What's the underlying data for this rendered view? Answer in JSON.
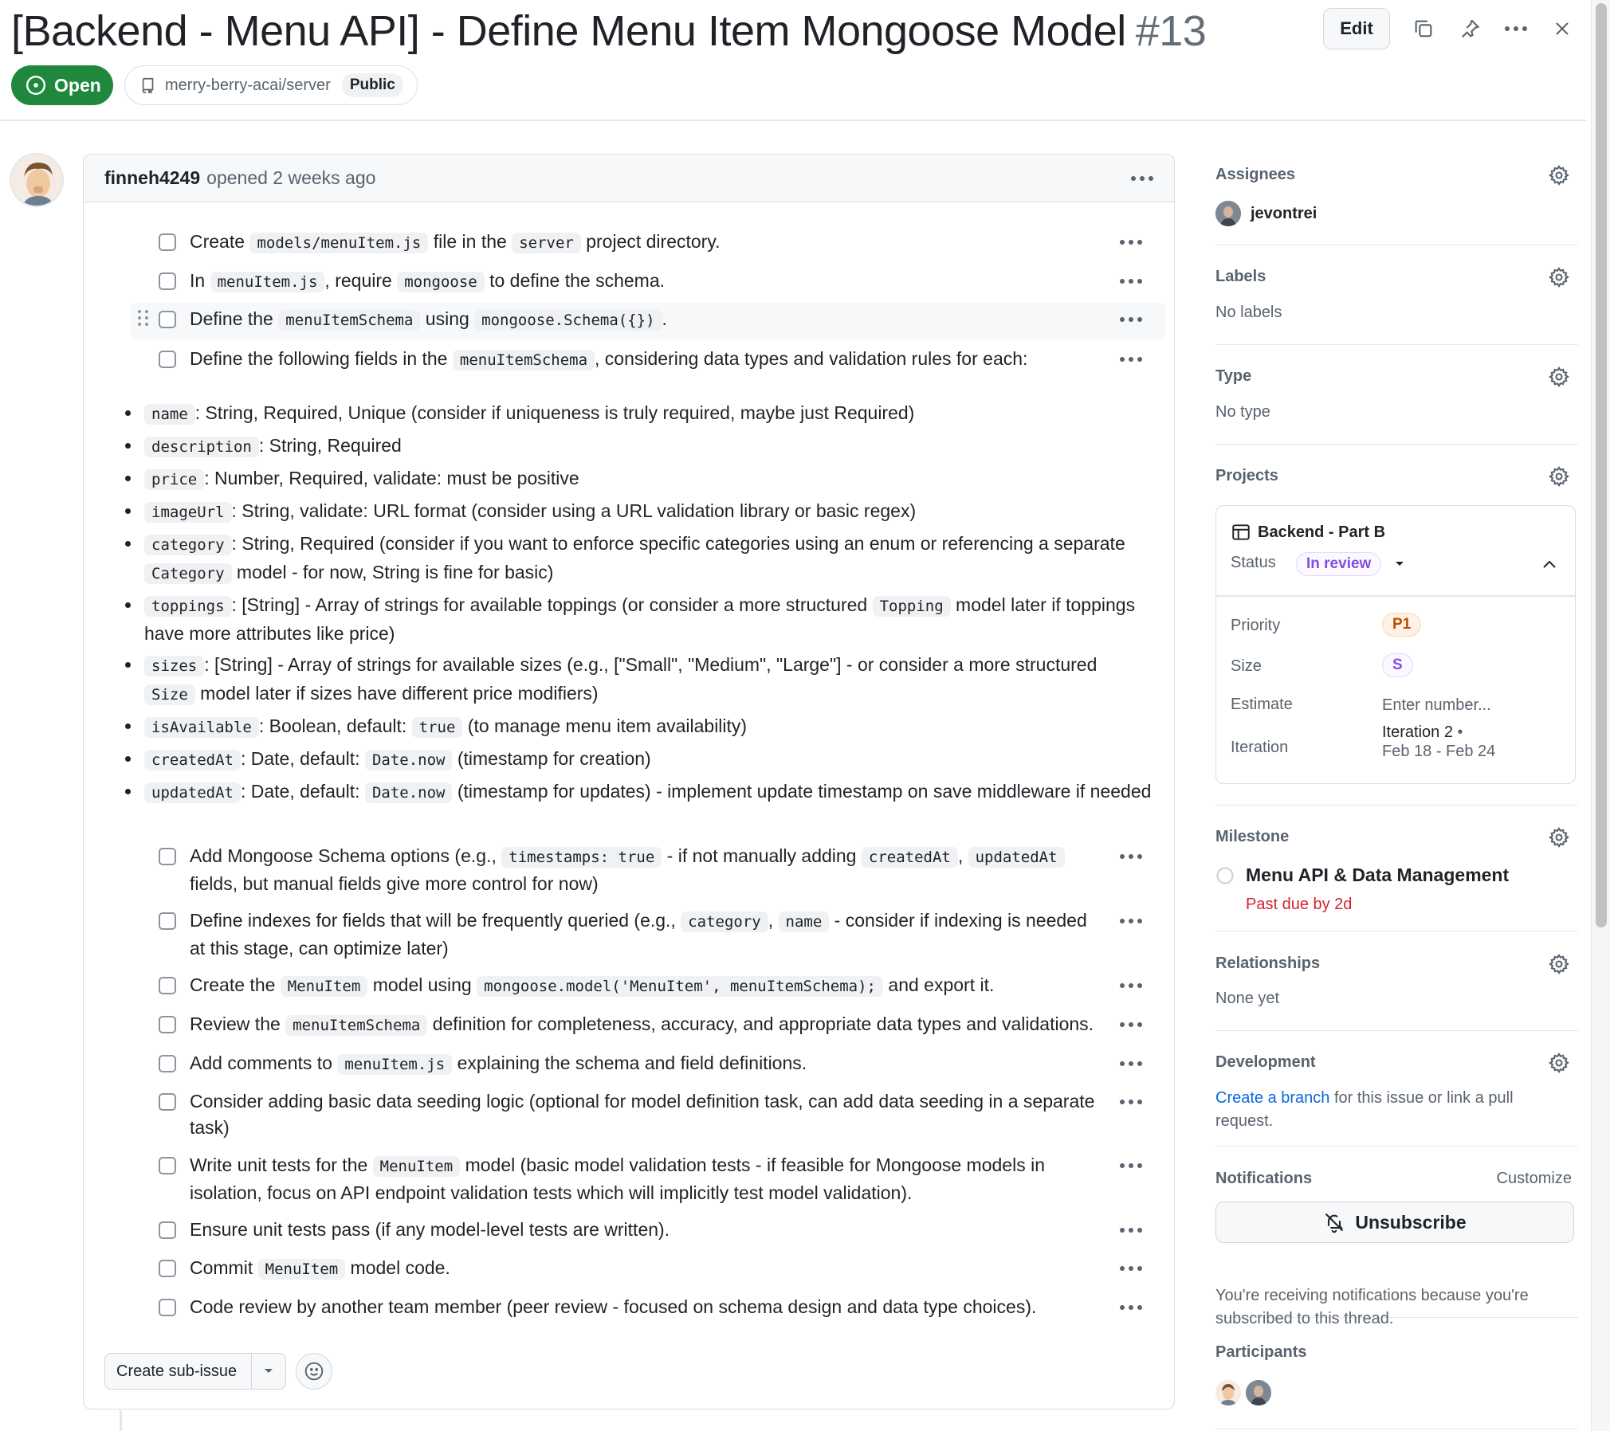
{
  "issue": {
    "title": "[Backend - Menu API] - Define Menu Item Mongoose Model",
    "number": "#13",
    "state": "Open",
    "repo": "merry-berry-acai/server",
    "visibility": "Public",
    "edit_label": "Edit"
  },
  "comment": {
    "author": "finneh4249",
    "meta": "opened 2 weeks ago"
  },
  "tasks_top": [
    [
      "Create ",
      {
        "code": "models/menuItem.js"
      },
      " file in the ",
      {
        "code": "server"
      },
      " project directory."
    ],
    [
      "In ",
      {
        "code": "menuItem.js"
      },
      ", require ",
      {
        "code": "mongoose"
      },
      " to define the schema."
    ],
    [
      "Define the ",
      {
        "code": "menuItemSchema"
      },
      " using ",
      {
        "code": "mongoose.Schema({})"
      },
      "."
    ],
    [
      "Define the following fields in the ",
      {
        "code": "menuItemSchema"
      },
      ", considering data types and validation rules for each:"
    ]
  ],
  "fields": [
    [
      {
        "code": "name"
      },
      ": String, Required, Unique (consider if uniqueness is truly required, maybe just Required)"
    ],
    [
      {
        "code": "description"
      },
      ": String, Required"
    ],
    [
      {
        "code": "price"
      },
      ": Number, Required, validate: must be positive"
    ],
    [
      {
        "code": "imageUrl"
      },
      ": String, validate: URL format (consider using a URL validation library or basic regex)"
    ],
    [
      {
        "code": "category"
      },
      ": String, Required (consider if you want to enforce specific categories using an enum or referencing a separate ",
      {
        "code": "Category"
      },
      " model - for now, String is fine for basic)"
    ],
    [
      {
        "code": "toppings"
      },
      ": [String] - Array of strings for available toppings (or consider a more structured ",
      {
        "code": "Topping"
      },
      " model later if toppings have more attributes like price)"
    ],
    [
      {
        "code": "sizes"
      },
      ": [String] - Array of strings for available sizes (e.g., [\"Small\", \"Medium\", \"Large\"] - or consider a more structured ",
      {
        "code": "Size"
      },
      " model later if sizes have different price modifiers)"
    ],
    [
      {
        "code": "isAvailable"
      },
      ": Boolean, default: ",
      {
        "code": "true"
      },
      " (to manage menu item availability)"
    ],
    [
      {
        "code": "createdAt"
      },
      ": Date, default: ",
      {
        "code": "Date.now"
      },
      " (timestamp for creation)"
    ],
    [
      {
        "code": "updatedAt"
      },
      ": Date, default: ",
      {
        "code": "Date.now"
      },
      " (timestamp for updates) - implement update timestamp on save middleware if needed"
    ]
  ],
  "tasks_bottom": [
    [
      "Add Mongoose Schema options (e.g., ",
      {
        "code": "timestamps: true"
      },
      " - if not manually adding ",
      {
        "code": "createdAt"
      },
      ", ",
      {
        "code": "updatedAt"
      },
      " fields, but manual fields give more control for now)"
    ],
    [
      "Define indexes for fields that will be frequently queried (e.g., ",
      {
        "code": "category"
      },
      ", ",
      {
        "code": "name"
      },
      " - consider if indexing is needed at this stage, can optimize later)"
    ],
    [
      "Create the ",
      {
        "code": "MenuItem"
      },
      " model using ",
      {
        "code": "mongoose.model('MenuItem', menuItemSchema);"
      },
      " and export it."
    ],
    [
      "Review the ",
      {
        "code": "menuItemSchema"
      },
      " definition for completeness, accuracy, and appropriate data types and validations."
    ],
    [
      "Add comments to ",
      {
        "code": "menuItem.js"
      },
      " explaining the schema and field definitions."
    ],
    [
      "Consider adding basic data seeding logic (optional for model definition task, can add data seeding in a separate task)"
    ],
    [
      "Write unit tests for the ",
      {
        "code": "MenuItem"
      },
      " model (basic model validation tests - if feasible for Mongoose models in isolation, focus on API endpoint validation tests which will implicitly test model validation)."
    ],
    [
      "Ensure unit tests pass (if any model-level tests are written)."
    ],
    [
      "Commit ",
      {
        "code": "MenuItem"
      },
      " model code."
    ],
    [
      "Code review by another team member (peer review - focused on schema design and data type choices)."
    ]
  ],
  "footer": {
    "create_sub_issue": "Create sub-issue"
  },
  "sidebar": {
    "assignees": {
      "title": "Assignees",
      "user": "jevontrei"
    },
    "labels": {
      "title": "Labels",
      "value": "No labels"
    },
    "type": {
      "title": "Type",
      "value": "No type"
    },
    "projects": {
      "title": "Projects",
      "name": "Backend - Part B",
      "status_label": "Status",
      "status": "In review",
      "priority_label": "Priority",
      "priority": "P1",
      "size_label": "Size",
      "size": "S",
      "estimate_label": "Estimate",
      "estimate_placeholder": "Enter number...",
      "iteration_label": "Iteration",
      "iteration": "Iteration 2",
      "iteration_dates": "Feb 18 - Feb 24"
    },
    "milestone": {
      "title": "Milestone",
      "name": "Menu API & Data Management",
      "due": "Past due by 2d"
    },
    "relationships": {
      "title": "Relationships",
      "value": "None yet"
    },
    "development": {
      "title": "Development",
      "link": "Create a branch",
      "rest": " for this issue or link a pull request."
    },
    "notifications": {
      "title": "Notifications",
      "customize": "Customize",
      "unsubscribe": "Unsubscribe",
      "note": "You're receiving notifications because you're subscribed to this thread."
    },
    "participants": {
      "title": "Participants"
    }
  },
  "colors": {
    "open_green": "#1f883d",
    "link_blue": "#0969da",
    "in_review": "#8250df",
    "priority": "#bc4c00",
    "past_due": "#d1242f"
  }
}
